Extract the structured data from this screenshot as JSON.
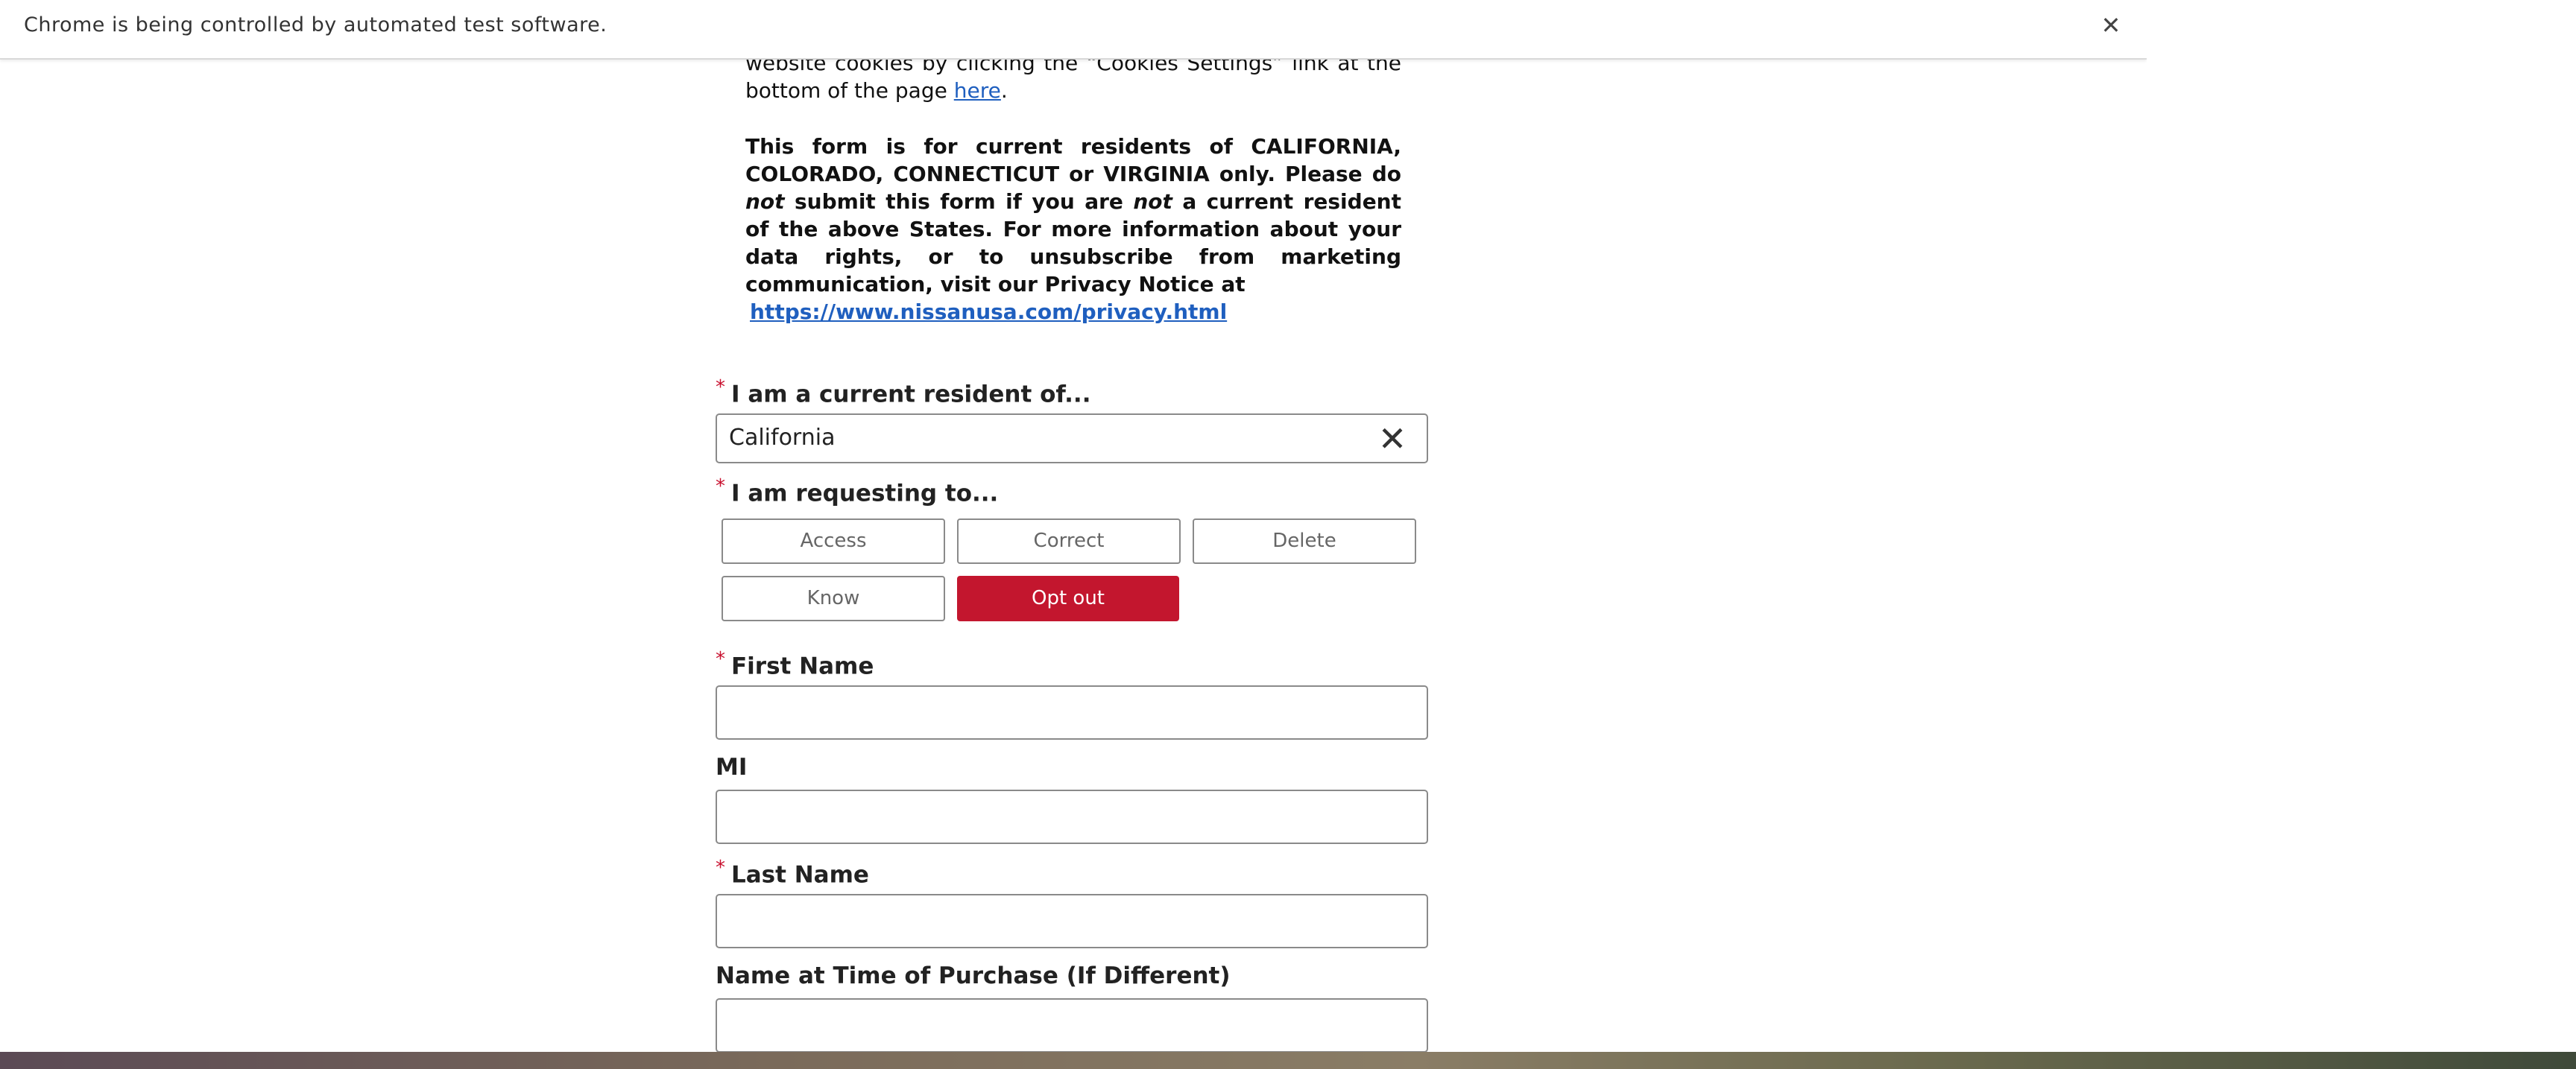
{
  "infobar": {
    "message": "Chrome is being controlled by automated test software.",
    "close_icon": "close-icon"
  },
  "intro": {
    "cookies_text": "website cookies by clicking the “Cookies Settings” link at the bottom of the page ",
    "cookies_link": "here",
    "cookies_end": ".",
    "notice_a": "This form is for current residents of CALIFORNIA, COLORADO, CONNECTICUT or VIRGINIA only. Please do ",
    "notice_not1": "not",
    "notice_b": " submit this form if you are ",
    "notice_not2": "not",
    "notice_c": " a current resident of the above States. For more information about your data rights, or to unsubscribe from marketing communication, visit our Privacy Notice at",
    "privacy_link": "https://www.nissanusa.com/privacy.html"
  },
  "form": {
    "required_mark": "*",
    "resident": {
      "label": "I am a current resident of...",
      "value": "California",
      "clear_icon": "close-icon"
    },
    "request": {
      "label": "I am requesting to...",
      "options": [
        "Access",
        "Correct",
        "Delete",
        "Know",
        "Opt out"
      ],
      "selected": "Opt out"
    },
    "first_name": {
      "label": "First Name",
      "value": ""
    },
    "mi": {
      "label": "MI",
      "value": ""
    },
    "last_name": {
      "label": "Last Name",
      "value": ""
    },
    "name_at_purchase": {
      "label": "Name at Time of Purchase (If Different)",
      "value": ""
    }
  },
  "colors": {
    "accent": "#c3162e",
    "link": "#1f5fbf",
    "required": "#c8102e"
  }
}
